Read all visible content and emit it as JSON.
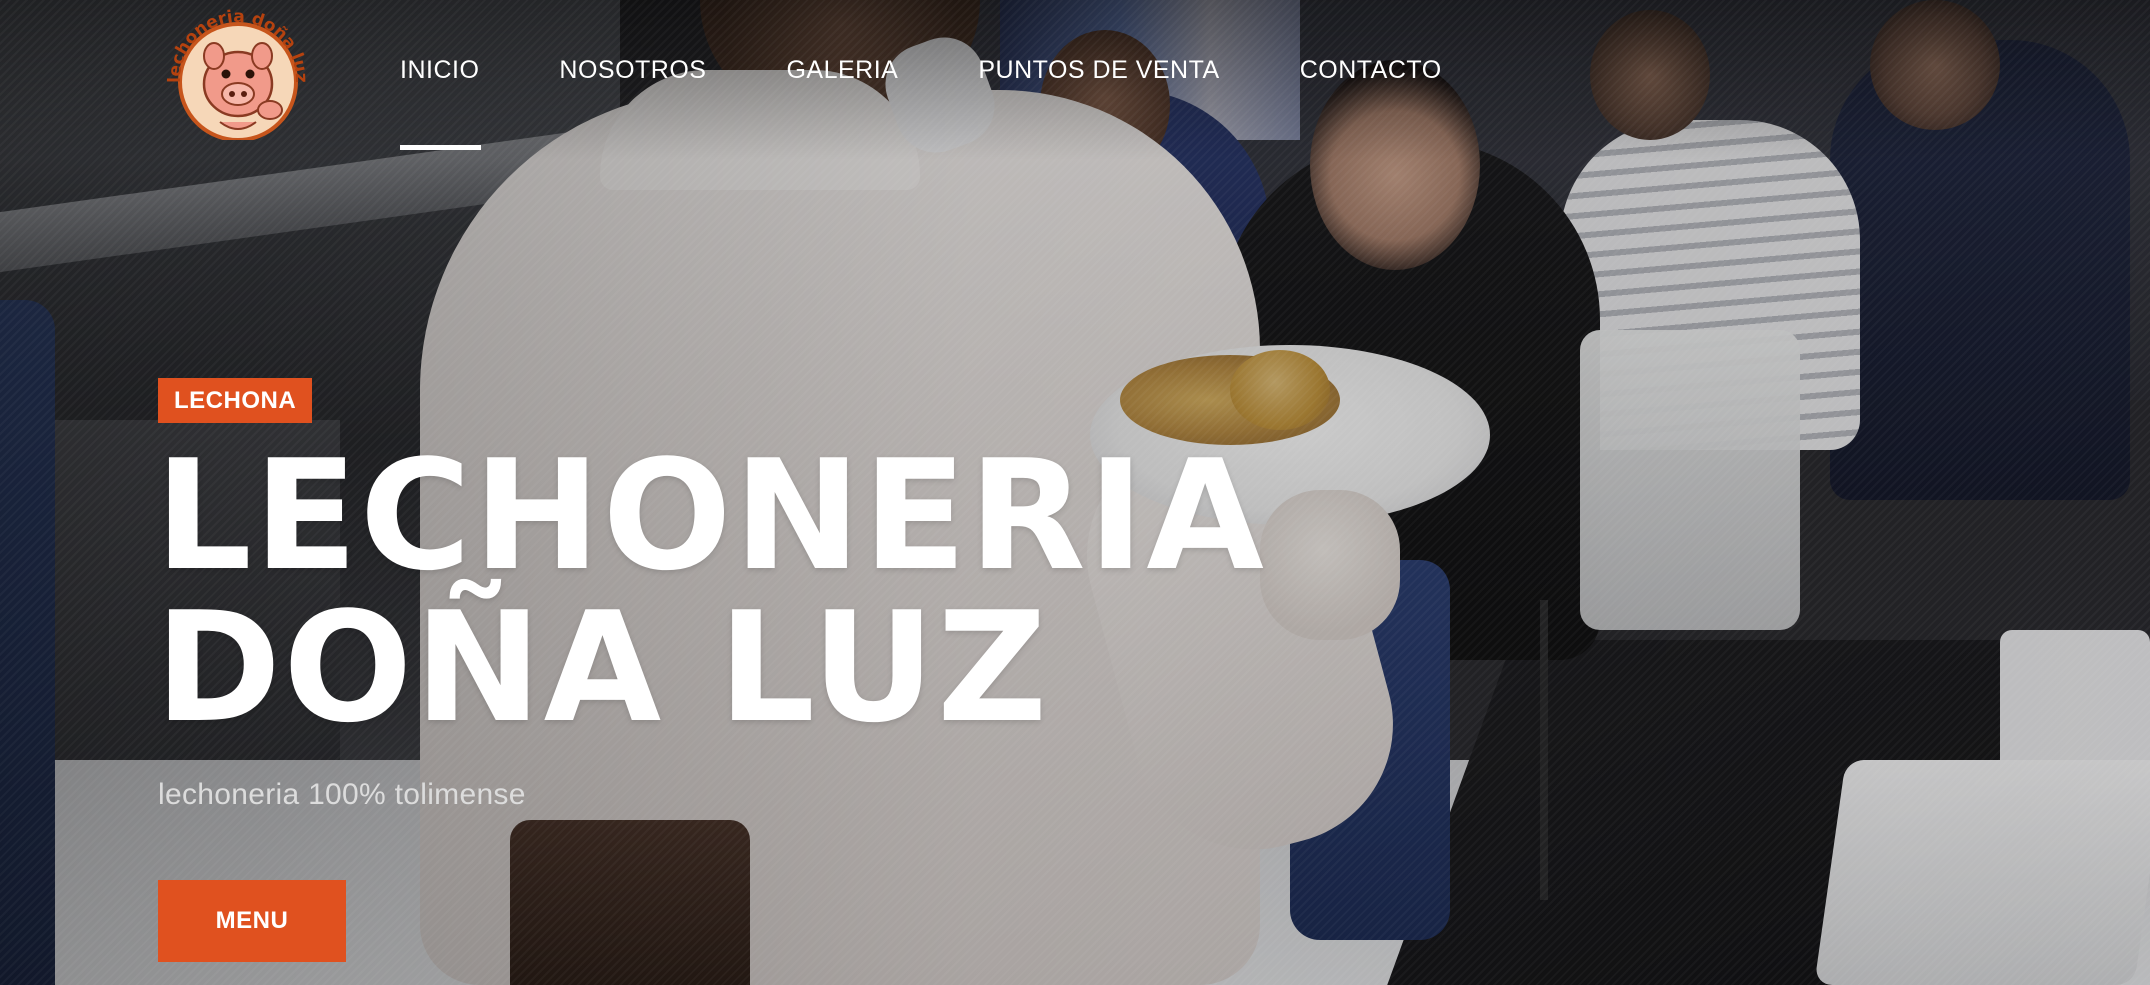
{
  "brand": {
    "logo_text": "lechoneria doña luz",
    "logo_icon": "pig-mascot-icon",
    "accent_color": "#e0511f"
  },
  "nav": {
    "items": [
      {
        "label": "INICIO",
        "active": true
      },
      {
        "label": "NOSOTROS",
        "active": false
      },
      {
        "label": "GALERIA",
        "active": false
      },
      {
        "label": "PUNTOS DE VENTA",
        "active": false
      },
      {
        "label": "CONTACTO",
        "active": false
      }
    ]
  },
  "hero": {
    "badge": "LECHONA",
    "title_line1": "LECHONERIA",
    "title_line2": "DOÑA LUZ",
    "subtitle": "lechoneria 100% tolimense",
    "cta_label": "MENU"
  }
}
